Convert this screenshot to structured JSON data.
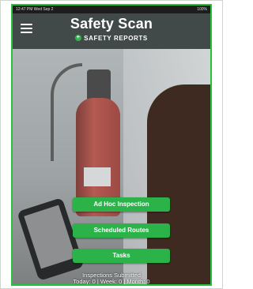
{
  "status_bar": {
    "time": "12:47 PM  Wed Sep 2",
    "battery": "100%"
  },
  "header": {
    "title": "Safety Scan",
    "subtitle": "SAFETY REPORTS",
    "subtitle_icon": "+"
  },
  "actions": {
    "ad_hoc": "Ad Hoc Inspection",
    "scheduled": "Scheduled Routes",
    "tasks": "Tasks"
  },
  "inspections": {
    "title": "Inspections Submitted",
    "counts": "Today: 0 | Week: 0 | Month: 0"
  },
  "colors": {
    "accent": "#2bb34a",
    "header": "#424949"
  }
}
